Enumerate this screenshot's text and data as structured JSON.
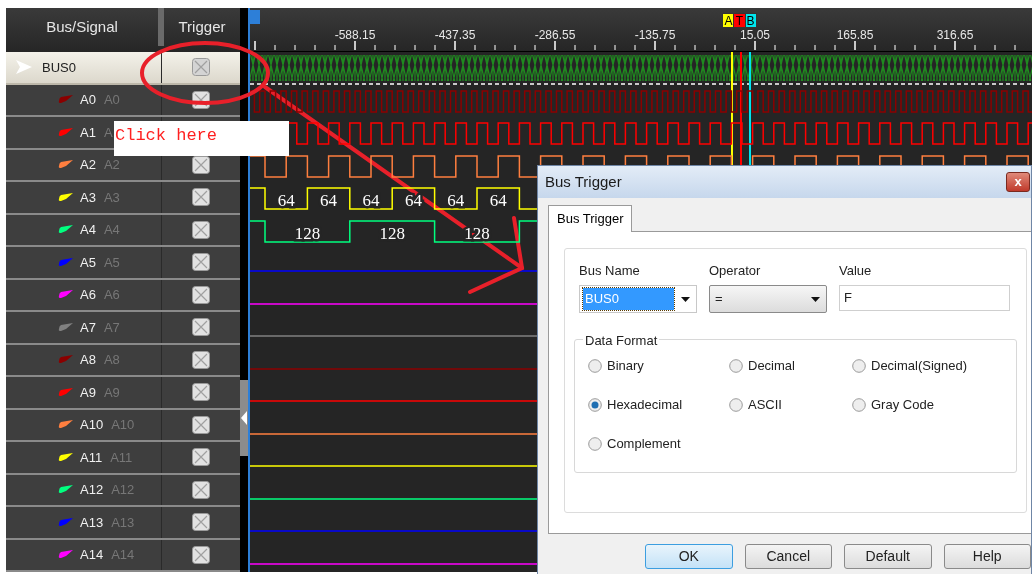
{
  "signal_panel": {
    "columns": [
      "Bus/Signal",
      "Trigger"
    ],
    "rows": [
      {
        "name": "BUS0",
        "alias": "",
        "kind": "bus",
        "selected": true,
        "values": []
      },
      {
        "name": "A0",
        "alias": "A0",
        "color": "#8b0000",
        "kind": "clock",
        "selected": false,
        "values": []
      },
      {
        "name": "A1",
        "alias": "A",
        "color": "#ff0000",
        "kind": "clock",
        "selected": false,
        "values": []
      },
      {
        "name": "A2",
        "alias": "A2",
        "color": "#ff7f3f",
        "kind": "clock",
        "selected": false,
        "values": []
      },
      {
        "name": "A3",
        "alias": "A3",
        "color": "#ffff00",
        "kind": "clock",
        "selected": false,
        "values": [
          "64",
          "64",
          "64",
          "64",
          "64",
          "64"
        ]
      },
      {
        "name": "A4",
        "alias": "A4",
        "color": "#00ff7f",
        "kind": "clock",
        "selected": false,
        "values": [
          "128",
          "128",
          "128"
        ]
      },
      {
        "name": "A5",
        "alias": "A5",
        "color": "#0000ff",
        "kind": "flat",
        "selected": false,
        "values": []
      },
      {
        "name": "A6",
        "alias": "A6",
        "color": "#ff00ff",
        "kind": "flat",
        "selected": false,
        "values": []
      },
      {
        "name": "A7",
        "alias": "A7",
        "color": "#808080",
        "kind": "flat",
        "selected": false,
        "values": []
      },
      {
        "name": "A8",
        "alias": "A8",
        "color": "#8b0000",
        "kind": "flat",
        "selected": false,
        "values": []
      },
      {
        "name": "A9",
        "alias": "A9",
        "color": "#ff0000",
        "kind": "flat",
        "selected": false,
        "values": []
      },
      {
        "name": "A10",
        "alias": "A10",
        "color": "#ff7f3f",
        "kind": "flat",
        "selected": false,
        "values": []
      },
      {
        "name": "A11",
        "alias": "A11",
        "color": "#ffff00",
        "kind": "flat",
        "selected": false,
        "values": []
      },
      {
        "name": "A12",
        "alias": "A12",
        "color": "#00ff7f",
        "kind": "flat",
        "selected": false,
        "values": []
      },
      {
        "name": "A13",
        "alias": "A13",
        "color": "#0000ff",
        "kind": "flat",
        "selected": false,
        "values": []
      },
      {
        "name": "A14",
        "alias": "A14",
        "color": "#ff00ff",
        "kind": "flat",
        "selected": false,
        "values": []
      }
    ]
  },
  "ruler": {
    "ticks": [
      "-588.15",
      "-437.35",
      "-286.55",
      "-135.75",
      "15.05",
      "165.85",
      "316.65"
    ],
    "cursors": [
      {
        "label": "A",
        "color": "#ffff00"
      },
      {
        "label": "T",
        "color": "#ff0000"
      },
      {
        "label": "B",
        "color": "#00e5ee"
      }
    ]
  },
  "annotation": {
    "text": "Click here"
  },
  "dialog": {
    "title": "Bus Trigger",
    "close": "x",
    "tabs": [
      {
        "label": "Bus Trigger",
        "selected": true
      }
    ],
    "fields": [
      {
        "label": "Bus Name",
        "kind": "combo",
        "value": "BUS0",
        "focused": true
      },
      {
        "label": "Operator",
        "kind": "combo",
        "value": "=",
        "focused": false
      },
      {
        "label": "Value",
        "kind": "text",
        "value": "F"
      }
    ],
    "data_format": {
      "title": "Data Format",
      "options": [
        {
          "label": "Binary",
          "selected": false
        },
        {
          "label": "Decimal",
          "selected": false
        },
        {
          "label": "Decimal(Signed)",
          "selected": false
        },
        {
          "label": "Hexadecimal",
          "selected": true
        },
        {
          "label": "ASCII",
          "selected": false
        },
        {
          "label": "Gray Code",
          "selected": false
        },
        {
          "label": "Complement",
          "selected": false
        }
      ]
    },
    "buttons": [
      {
        "label": "OK",
        "default": true
      },
      {
        "label": "Cancel",
        "default": false
      },
      {
        "label": "Default",
        "default": false
      },
      {
        "label": "Help",
        "default": false
      }
    ]
  }
}
